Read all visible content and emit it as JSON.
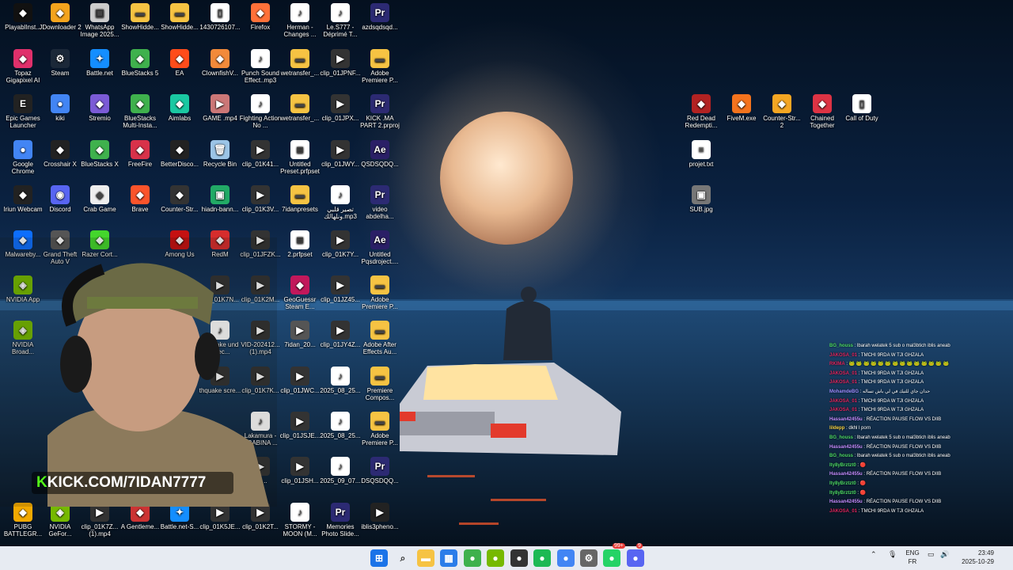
{
  "desktop": {
    "icons": [
      {
        "label": "PlayablInst...",
        "icon": "p-icon",
        "color": "#111"
      },
      {
        "label": "JDownloader 2",
        "icon": "jdownloader-icon",
        "color": "#f4a41d"
      },
      {
        "label": "WhatsApp Image 2025...",
        "icon": "image-icon",
        "color": "#ccc"
      },
      {
        "label": "ShowHidde...",
        "icon": "folder-icon",
        "color": "#f6c343"
      },
      {
        "label": "ShowHidde...",
        "icon": "folder-icon",
        "color": "#f6c343"
      },
      {
        "label": "1430726107...",
        "icon": "file-icon",
        "color": "#fff"
      },
      {
        "label": "Firefox",
        "icon": "firefox-icon",
        "color": "#ff7139"
      },
      {
        "label": "Herman - Changes ...",
        "icon": "audio-file-icon",
        "color": "#fff"
      },
      {
        "label": "Le.S777 - Déprimé T...",
        "icon": "audio-file-icon",
        "color": "#fff"
      },
      {
        "label": "azdsqdsqd...",
        "icon": "premiere-icon",
        "color": "#2c2a73"
      },
      {
        "label": "Topaz Gigapixel AI",
        "icon": "topaz-icon",
        "color": "#e0306b"
      },
      {
        "label": "Steam",
        "icon": "steam-icon",
        "color": "#1b2838"
      },
      {
        "label": "Battle.net",
        "icon": "battlenet-icon",
        "color": "#148eff"
      },
      {
        "label": "BlueStacks 5",
        "icon": "bluestacks-icon",
        "color": "#3fb14d"
      },
      {
        "label": "EA",
        "icon": "ea-icon",
        "color": "#ff4c1a"
      },
      {
        "label": "ClownfishV...",
        "icon": "clownfish-icon",
        "color": "#f28a3a"
      },
      {
        "label": "Punch Sound Effect..mp3",
        "icon": "audio-file-icon",
        "color": "#fff"
      },
      {
        "label": "wetransfer_...",
        "icon": "folder-icon",
        "color": "#f6c343"
      },
      {
        "label": "clip_01JPNF...",
        "icon": "video-file-icon",
        "color": "#333"
      },
      {
        "label": "Adobe Premiere P...",
        "icon": "folder-icon",
        "color": "#f6c343"
      },
      {
        "label": "Epic Games Launcher",
        "icon": "epic-icon",
        "color": "#222"
      },
      {
        "label": "kiki",
        "icon": "chrome-icon",
        "color": "#4285f4"
      },
      {
        "label": "Stremio",
        "icon": "stremio-icon",
        "color": "#7b5bd6"
      },
      {
        "label": "BlueStacks Multi-Insta...",
        "icon": "bluestacks-icon",
        "color": "#3fb14d"
      },
      {
        "label": "Aimlabs",
        "icon": "aimlabs-icon",
        "color": "#1ac8a2"
      },
      {
        "label": "GAME .mp4",
        "icon": "video-file-icon",
        "color": "#c77"
      },
      {
        "label": "Fighting Action No ...",
        "icon": "audio-file-icon",
        "color": "#fff"
      },
      {
        "label": "wetransfer_...",
        "icon": "folder-icon",
        "color": "#f6c343"
      },
      {
        "label": "clip_01JPX...",
        "icon": "video-file-icon",
        "color": "#333"
      },
      {
        "label": "KICK .MA PART 2.prproj",
        "icon": "premiere-icon",
        "color": "#2c2a73"
      },
      {
        "label": "Google Chrome",
        "icon": "chrome-icon",
        "color": "#4285f4"
      },
      {
        "label": "Crosshair X",
        "icon": "crosshair-icon",
        "color": "#222"
      },
      {
        "label": "BlueStacks X",
        "icon": "bluestacks-icon",
        "color": "#3fb14d"
      },
      {
        "label": "FreeFire",
        "icon": "freefire-icon",
        "color": "#d8324a"
      },
      {
        "label": "BetterDisco...",
        "icon": "app-icon",
        "color": "#222"
      },
      {
        "label": "Recycle Bin",
        "icon": "recycle-bin-icon",
        "color": "#9bc4e6"
      },
      {
        "label": "clip_01K41...",
        "icon": "video-file-icon",
        "color": "#333"
      },
      {
        "label": "Untitled Preset.prfpset",
        "icon": "preset-file-icon",
        "color": "#fff"
      },
      {
        "label": "clip_01JWY...",
        "icon": "video-file-icon",
        "color": "#333"
      },
      {
        "label": "QSDSQDQ...",
        "icon": "after-effects-icon",
        "color": "#2a1f66"
      },
      {
        "label": "Iriun Webcam",
        "icon": "webcam-icon",
        "color": "#222"
      },
      {
        "label": "Discord",
        "icon": "discord-icon",
        "color": "#5865f2"
      },
      {
        "label": "Crab Game",
        "icon": "crab-game-icon",
        "color": "#eee"
      },
      {
        "label": "Brave",
        "icon": "brave-icon",
        "color": "#fb542b"
      },
      {
        "label": "Counter-Str...",
        "icon": "cs-icon",
        "color": "#333"
      },
      {
        "label": "hiadn-bann...",
        "icon": "image-icon",
        "color": "#2a6"
      },
      {
        "label": "clip_01K3V...",
        "icon": "video-file-icon",
        "color": "#333"
      },
      {
        "label": "7idanpresets",
        "icon": "folder-icon",
        "color": "#f6c343"
      },
      {
        "label": "تصير قلبي ونلهالك.mp3",
        "icon": "audio-file-icon",
        "color": "#fff"
      },
      {
        "label": "video abdelha...",
        "icon": "premiere-icon",
        "color": "#2c2a73"
      },
      {
        "label": "Malwareby...",
        "icon": "malwarebytes-icon",
        "color": "#0d6efd"
      },
      {
        "label": "Grand Theft Auto V",
        "icon": "gta-icon",
        "color": "#555"
      },
      {
        "label": "Razer Cort...",
        "icon": "razer-icon",
        "color": "#44d62c"
      },
      {
        "label": "Among Us",
        "icon": "among-us-icon",
        "color": "#c51111"
      },
      {
        "label": "RedM",
        "icon": "redm-icon",
        "color": "#d62d2d"
      },
      {
        "label": "clip_01JFZK...",
        "icon": "video-file-icon",
        "color": "#333"
      },
      {
        "label": "2.prfpset",
        "icon": "preset-file-icon",
        "color": "#fff"
      },
      {
        "label": "clip_01K7Y...",
        "icon": "video-file-icon",
        "color": "#333"
      },
      {
        "label": "Untitled Pqsdroject....",
        "icon": "after-effects-icon",
        "color": "#2a1f66"
      },
      {
        "label": "NVIDIA App",
        "icon": "nvidia-icon",
        "color": "#76b900"
      },
      {
        "label": "clip_01K7N...",
        "icon": "video-file-icon",
        "color": "#333"
      },
      {
        "label": "clip_01K2M...",
        "icon": "video-file-icon",
        "color": "#333"
      },
      {
        "label": "GeoGuessr Steam E...",
        "icon": "geoguessr-icon",
        "color": "#c2185b"
      },
      {
        "label": "clip_01JZ45...",
        "icon": "video-file-icon",
        "color": "#333"
      },
      {
        "label": "Adobe Premiere P...",
        "icon": "folder-icon",
        "color": "#f6c343"
      },
      {
        "label": "NVIDIA Broad...",
        "icon": "nvidia-icon",
        "color": "#76b900"
      },
      {
        "label": "rthquake und Effec...",
        "icon": "audio-file-icon",
        "color": "#fff"
      },
      {
        "label": "VID-202412... (1).mp4",
        "icon": "video-file-icon",
        "color": "#333"
      },
      {
        "label": "7idan_20...",
        "icon": "video-file-icon",
        "color": "#555"
      },
      {
        "label": "clip_01JY4Z...",
        "icon": "video-file-icon",
        "color": "#333"
      },
      {
        "label": "Adobe After Effects Au...",
        "icon": "folder-icon",
        "color": "#f6c343"
      },
      {
        "label": "thquake scre...",
        "icon": "video-file-icon",
        "color": "#333"
      },
      {
        "label": "clip_01K7K...",
        "icon": "video-file-icon",
        "color": "#333"
      },
      {
        "label": "clip_01JWC...",
        "icon": "video-file-icon",
        "color": "#333"
      },
      {
        "label": "2025_08_25...",
        "icon": "audio-file-icon",
        "color": "#fff"
      },
      {
        "label": "Premiere Compos...",
        "icon": "folder-icon",
        "color": "#f6c343"
      },
      {
        "label": "Lakamura - ARABINA ...",
        "icon": "audio-file-icon",
        "color": "#fff"
      },
      {
        "label": "clip_01JSJE...",
        "icon": "video-file-icon",
        "color": "#333"
      },
      {
        "label": "2025_08_25...",
        "icon": "audio-file-icon",
        "color": "#fff"
      },
      {
        "label": "Adobe Premiere P...",
        "icon": "folder-icon",
        "color": "#f6c343"
      },
      {
        "label": "7Q...",
        "icon": "video-file-icon",
        "color": "#333"
      },
      {
        "label": "clip_01JSH...",
        "icon": "video-file-icon",
        "color": "#333"
      },
      {
        "label": "2025_09_07...",
        "icon": "audio-file-icon",
        "color": "#fff"
      },
      {
        "label": "DSQSDQQ...",
        "icon": "premiere-icon",
        "color": "#2c2a73"
      },
      {
        "label": "PUBG BATTLEGR...",
        "icon": "pubg-icon",
        "color": "#f2a900"
      },
      {
        "label": "NVIDIA GeFor...",
        "icon": "nvidia-icon",
        "color": "#76b900"
      },
      {
        "label": "clip_01K7Z... (1).mp4",
        "icon": "video-file-icon",
        "color": "#333"
      },
      {
        "label": "A Gentleme...",
        "icon": "game-icon",
        "color": "#c33"
      },
      {
        "label": "Battle.net-S...",
        "icon": "battlenet-icon",
        "color": "#148eff"
      },
      {
        "label": "clip_01K5JE...",
        "icon": "video-file-icon",
        "color": "#333"
      },
      {
        "label": "clip_01K2T...",
        "icon": "video-file-icon",
        "color": "#333"
      },
      {
        "label": "STORMY - MOON (M...",
        "icon": "audio-file-icon",
        "color": "#fff"
      },
      {
        "label": "Memories Photo Slide...",
        "icon": "premiere-icon",
        "color": "#2c2a73"
      },
      {
        "label": "iblis3pheno...",
        "icon": "video-file-icon",
        "color": "#222"
      },
      {
        "label": "Red Dead Redempti...",
        "icon": "rdr-icon",
        "color": "#b22222"
      },
      {
        "label": "FiveM.exe",
        "icon": "fivem-icon",
        "color": "#f4731d"
      },
      {
        "label": "Counter-Str... 2",
        "icon": "cs2-icon",
        "color": "#f5a623"
      },
      {
        "label": "Chained Together",
        "icon": "chained-together-icon",
        "color": "#d34"
      },
      {
        "label": "Call of Duty",
        "icon": "file-icon",
        "color": "#fff"
      },
      {
        "label": "projet.txt",
        "icon": "text-file-icon",
        "color": "#fff"
      },
      {
        "label": "SUB.jpg",
        "icon": "image-icon",
        "color": "#777"
      }
    ]
  },
  "webcam": {
    "overlay_url_prefix": "K",
    "overlay_url": "KICK.COM/7IDAN7777",
    "accent": "#53fc18"
  },
  "chat": {
    "messages": [
      {
        "user": "BG_houss",
        "text": "lbarah welatek 5 sub o mal3btich iblis aneab",
        "color": "#4cd964"
      },
      {
        "user": "JAKOSA_01",
        "text": "TMCHI 9RDA W TJI GHZALA",
        "color": "#e0245e"
      },
      {
        "user": "RKIMA",
        "text": "🐸 🐸 🐸 🐸 🐸 🐸 🐸 🐸 🐸 🐸 🐸 🐸 🐸 🐸",
        "color": "#e0245e"
      },
      {
        "user": "JAKOSA_01",
        "text": "TMCHI 9RDA W TJI GHZALA",
        "color": "#e0245e"
      },
      {
        "user": "JAKOSA_01",
        "text": "TMCHI 9RDA W TJI GHZALA",
        "color": "#e0245e"
      },
      {
        "user": "MohamdeBG",
        "text": "حدان جاي للتيك في لي باش تساله",
        "color": "#9b8cff"
      },
      {
        "user": "JAKOSA_01",
        "text": "TMCHI 9RDA W TJI GHZALA",
        "color": "#e0245e"
      },
      {
        "user": "JAKOSA_01",
        "text": "TMCHI 9RDA W TJI GHZALA",
        "color": "#e0245e"
      },
      {
        "user": "Hassan42455u",
        "text": "RÉACTION PAUSE FLOW VS DIIB",
        "color": "#c58cff"
      },
      {
        "user": "lildepp",
        "text": "dkhl l porn",
        "color": "#f5d142"
      },
      {
        "user": "BG_houss",
        "text": "lbarah welatek 5 sub o mal3btich iblis aneab",
        "color": "#4cd964"
      },
      {
        "user": "Hassan42455u",
        "text": "RÉACTION PAUSE FLOW VS DIIB",
        "color": "#c58cff"
      },
      {
        "user": "BG_houss",
        "text": "lbarah welatek 5 sub o mal3btich iblis aneab",
        "color": "#4cd964"
      },
      {
        "user": "lty8yBrztzt0",
        "text": "🔴",
        "color": "#4cd964"
      },
      {
        "user": "Hassan42455u",
        "text": "RÉACTION PAUSE FLOW VS DIIB",
        "color": "#c58cff"
      },
      {
        "user": "lty8yBrztzt0",
        "text": "🔴",
        "color": "#4cd964"
      },
      {
        "user": "lty8yBrztzt0",
        "text": "🔴",
        "color": "#4cd964"
      },
      {
        "user": "Hassan42455u",
        "text": "RÉACTION PAUSE FLOW VS DIIB",
        "color": "#c58cff"
      },
      {
        "user": "JAKOSA_01",
        "text": "TMCHI 9RDA W TJI GHZALA",
        "color": "#e0245e"
      }
    ]
  },
  "taskbar": {
    "apps": [
      {
        "name": "start",
        "icon": "windows-icon",
        "color": "#1a73e8"
      },
      {
        "name": "search",
        "icon": "search-icon",
        "color": "#333"
      },
      {
        "name": "file-explorer",
        "icon": "folder-icon",
        "color": "#f6c343"
      },
      {
        "name": "microsoft-store",
        "icon": "store-icon",
        "color": "#2b7de9"
      },
      {
        "name": "bluestacks",
        "icon": "bluestacks-icon",
        "color": "#3fb14d"
      },
      {
        "name": "nvidia",
        "icon": "nvidia-icon",
        "color": "#76b900"
      },
      {
        "name": "obs",
        "icon": "obs-icon",
        "color": "#333"
      },
      {
        "name": "spotify",
        "icon": "spotify-icon",
        "color": "#1db954"
      },
      {
        "name": "chrome",
        "icon": "chrome-icon",
        "color": "#4285f4"
      },
      {
        "name": "settings",
        "icon": "gear-icon",
        "color": "#666"
      },
      {
        "name": "whatsapp",
        "icon": "whatsapp-icon",
        "color": "#25d366"
      },
      {
        "name": "discord",
        "icon": "discord-icon",
        "color": "#5865f2"
      }
    ],
    "whatsapp_badge": "99+",
    "discord_badge": "9",
    "lang_top": "ENG",
    "lang_bottom": "FR",
    "time": "23:49",
    "date": "2025-10-29"
  }
}
